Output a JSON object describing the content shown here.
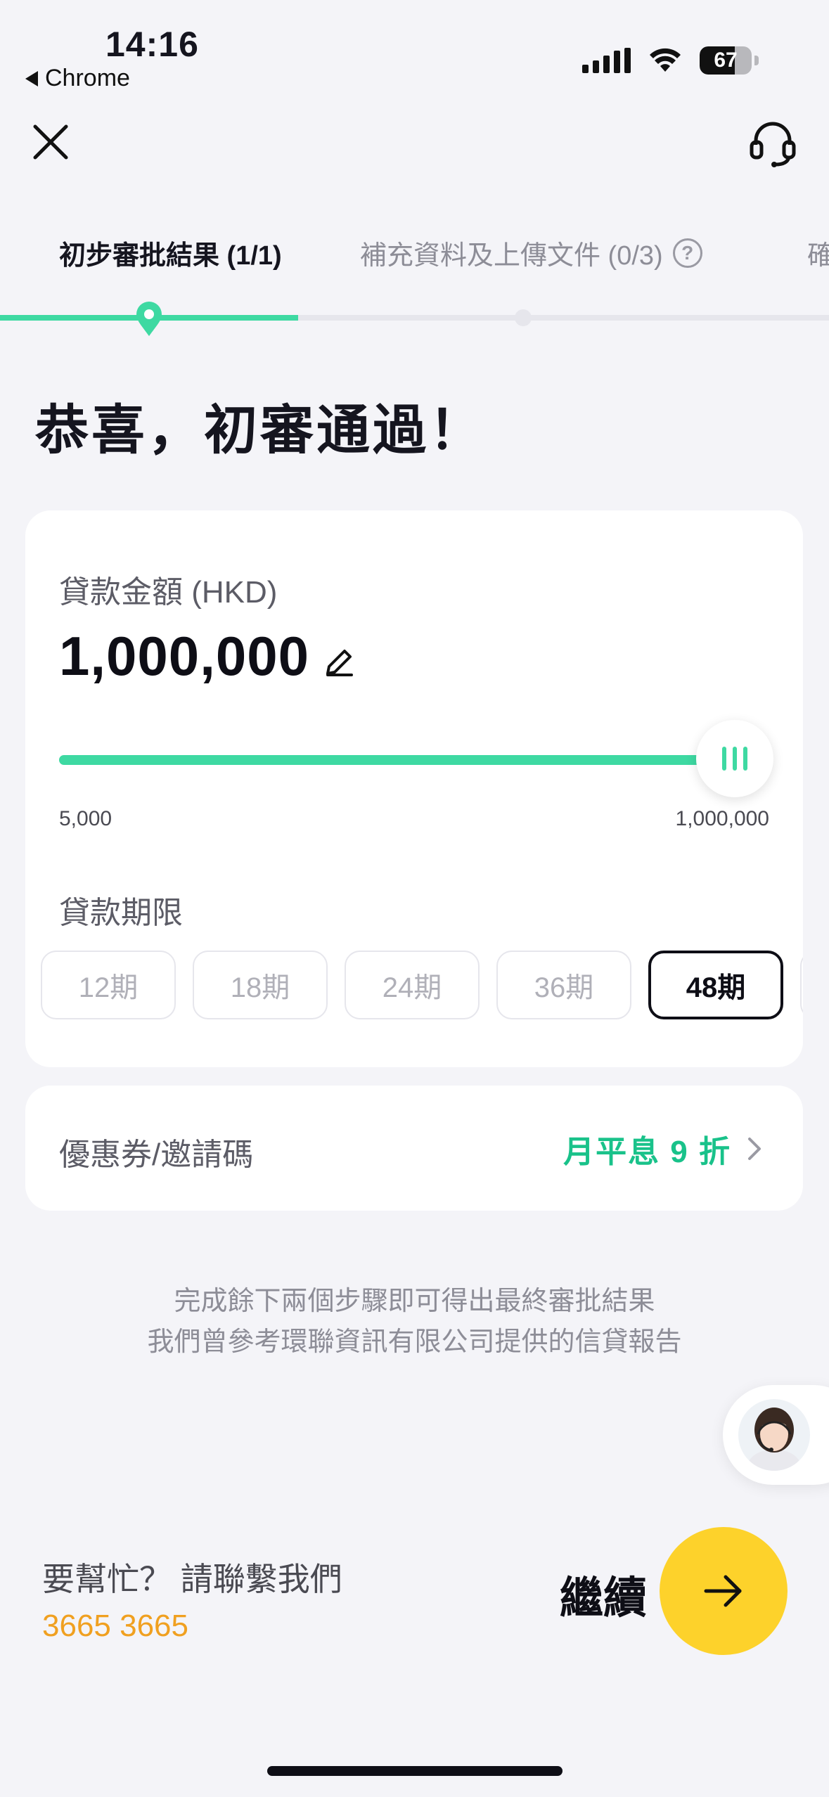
{
  "status_bar": {
    "time": "14:16",
    "back_app": "Chrome",
    "battery": "67",
    "battery_level": 0.67
  },
  "nav": {
    "close_icon": "close-icon",
    "support_icon": "headset-icon"
  },
  "steps": [
    {
      "label": "初步審批結果 (1/1)",
      "active": true
    },
    {
      "label": "補充資料及上傳文件 (0/3)",
      "active": false
    },
    {
      "label": "確",
      "active": false
    }
  ],
  "step_help_glyph": "?",
  "step_progress": 0.36,
  "headline": "恭喜，初審通過！",
  "loan": {
    "amount_label": "貸款金額 (HKD)",
    "amount_value": "1,000,000",
    "slider_min": "5,000",
    "slider_max": "1,000,000",
    "slider_level": 1.0,
    "term_label": "貸款期限",
    "terms": [
      "12期",
      "18期",
      "24期",
      "36期",
      "48期"
    ],
    "selected_term": "48期"
  },
  "coupon": {
    "label": "優惠券/邀請碼",
    "value": "月平息 9 折"
  },
  "notes": [
    "完成餘下兩個步驟即可得出最終審批結果",
    "我們曾參考環聯資訊有限公司提供的信貸報告"
  ],
  "help": {
    "text": "要幫忙？ 請聯繫我們",
    "phone": "3665 3665"
  },
  "continue_label": "繼續",
  "colors": {
    "accent_green": "#3ed9a2",
    "coupon_green": "#19c28a",
    "phone_orange": "#f0a020",
    "button_yellow": "#fdd22b"
  }
}
